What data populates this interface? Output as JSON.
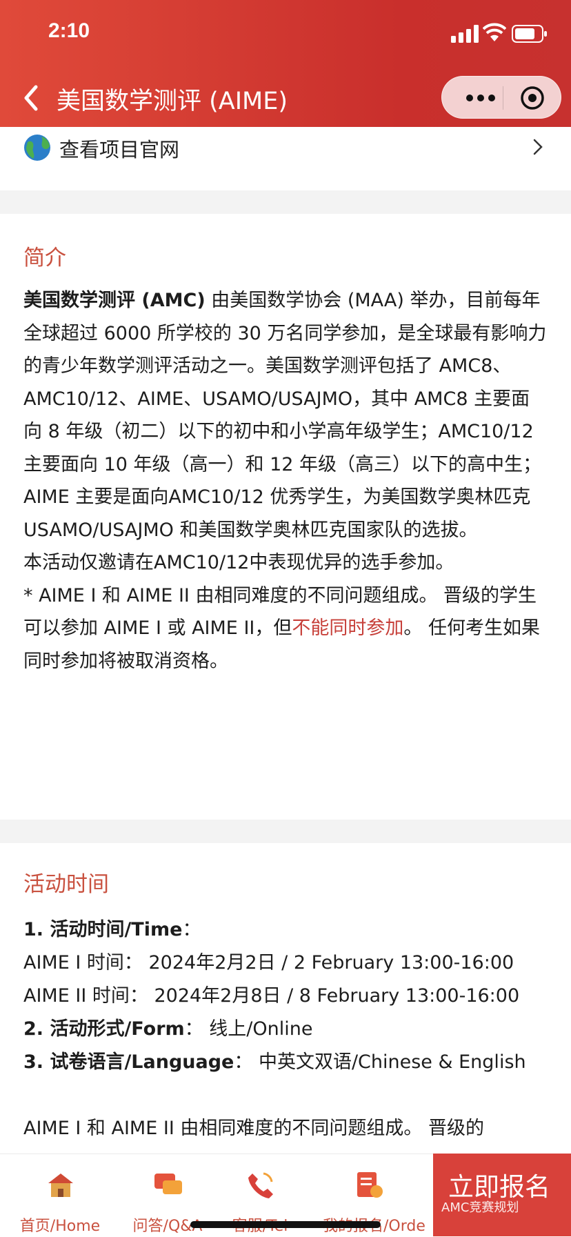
{
  "status": {
    "time": "2:10"
  },
  "nav": {
    "title": "美国数学测评 (AIME)"
  },
  "site": {
    "label": "查看项目官网"
  },
  "intro": {
    "heading": "简介",
    "p1_bold": "美国数学测评 (AMC)",
    "p1_rest": " 由美国数学协会 (MAA) 举办，目前每年全球超过 6000 所学校的 30 万名同学参加，是全球最有影响力的青少年数学测评活动之一。美国数学测评包括了 AMC8、AMC10/12、AIME、USAMO/USAJMO，其中 AMC8 主要面向 8 年级（初二）以下的初中和小学高年级学生；AMC10/12 主要面向 10 年级（高一）和 12 年级（高三）以下的高中生；AIME 主要是面向AMC10/12 优秀学生，为美国数学奥林匹克 USAMO/USAJMO 和美国数学奥林匹克国家队的选拔。",
    "p2": "本活动仅邀请在AMC10/12中表现优异的选手参加。",
    "p3_a": "* AIME I 和 AIME II 由相同难度的不同问题组成。 晋级的学生可以参加 AIME I 或 AIME II，但",
    "p3_red": "不能同时参加",
    "p3_b": "。 任何考生如果同时参加将被取消资格。"
  },
  "schedule": {
    "heading": "活动时间",
    "l1_bold": "1. 活动时间/Time",
    "l1_rest": "：",
    "l2": "AIME I 时间： 2024年2月2日 / 2 February 13:00-16:00",
    "l3": "AIME II 时间： 2024年2月8日 / 8 February 13:00-16:00",
    "l4_bold": "2. 活动形式/Form",
    "l4_rest": "： 线上/Online",
    "l5_bold": "3. 试卷语言/Language",
    "l5_rest": "： 中英文双语/Chinese & English",
    "l6": "AIME I 和 AIME II 由相同难度的不同问题组成。 晋级的"
  },
  "tabs": {
    "home": "首页/Home",
    "qa": "问答/Q&A",
    "service": "客服/Tel",
    "orders": "我的报名/Orders",
    "signup": "立即报名"
  },
  "watermark": "AMC竞赛规划"
}
